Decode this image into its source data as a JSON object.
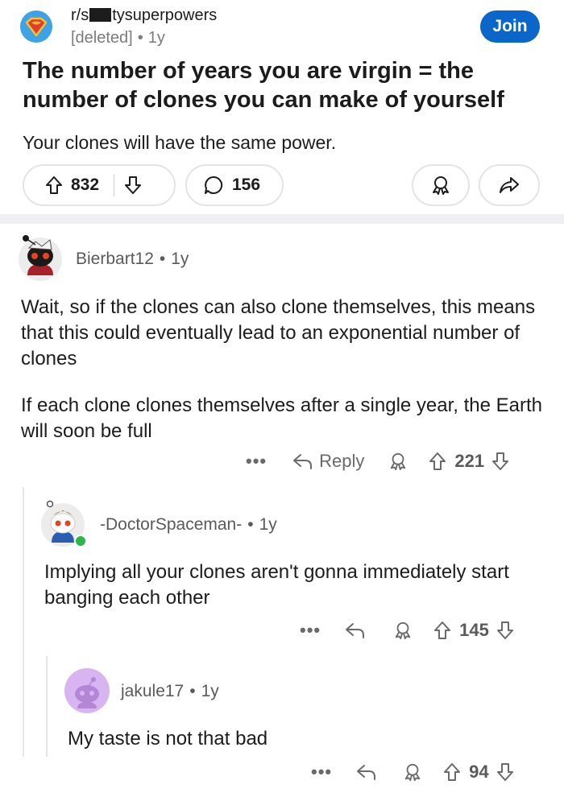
{
  "post": {
    "subreddit_prefix": "r/s",
    "subreddit_suffix": "tysuperpowers",
    "author": "[deleted]",
    "age": "1y",
    "join_label": "Join",
    "title": "The number of years you are virgin = the number of clones you can make of yourself",
    "body": "Your clones will have the same power.",
    "upvotes": "832",
    "comments": "156"
  },
  "comments": [
    {
      "username": "Bierbart12",
      "age": "1y",
      "paragraphs": [
        "Wait, so if the clones can also clone themselves, this means that this could eventually lead to an exponential number of clones",
        "If each clone clones themselves after a single year, the Earth will soon be full"
      ],
      "reply_label": "Reply",
      "score": "221"
    },
    {
      "username": "-DoctorSpaceman-",
      "age": "1y",
      "text": "Implying all your clones aren't gonna immediately start banging each other",
      "score": "145"
    },
    {
      "username": "jakule17",
      "age": "1y",
      "text": "My taste is not that bad",
      "score": "94"
    }
  ],
  "ui": {
    "more_glyph": "•••",
    "separator": "•"
  },
  "colors": {
    "join_button": "#0a66c8",
    "icon_gray": "#6a6a6a",
    "online": "#2bb54a"
  },
  "icons": [
    "superhero-subreddit-icon",
    "upvote-icon",
    "downvote-icon",
    "comment-icon",
    "award-icon",
    "share-icon",
    "reply-icon"
  ]
}
